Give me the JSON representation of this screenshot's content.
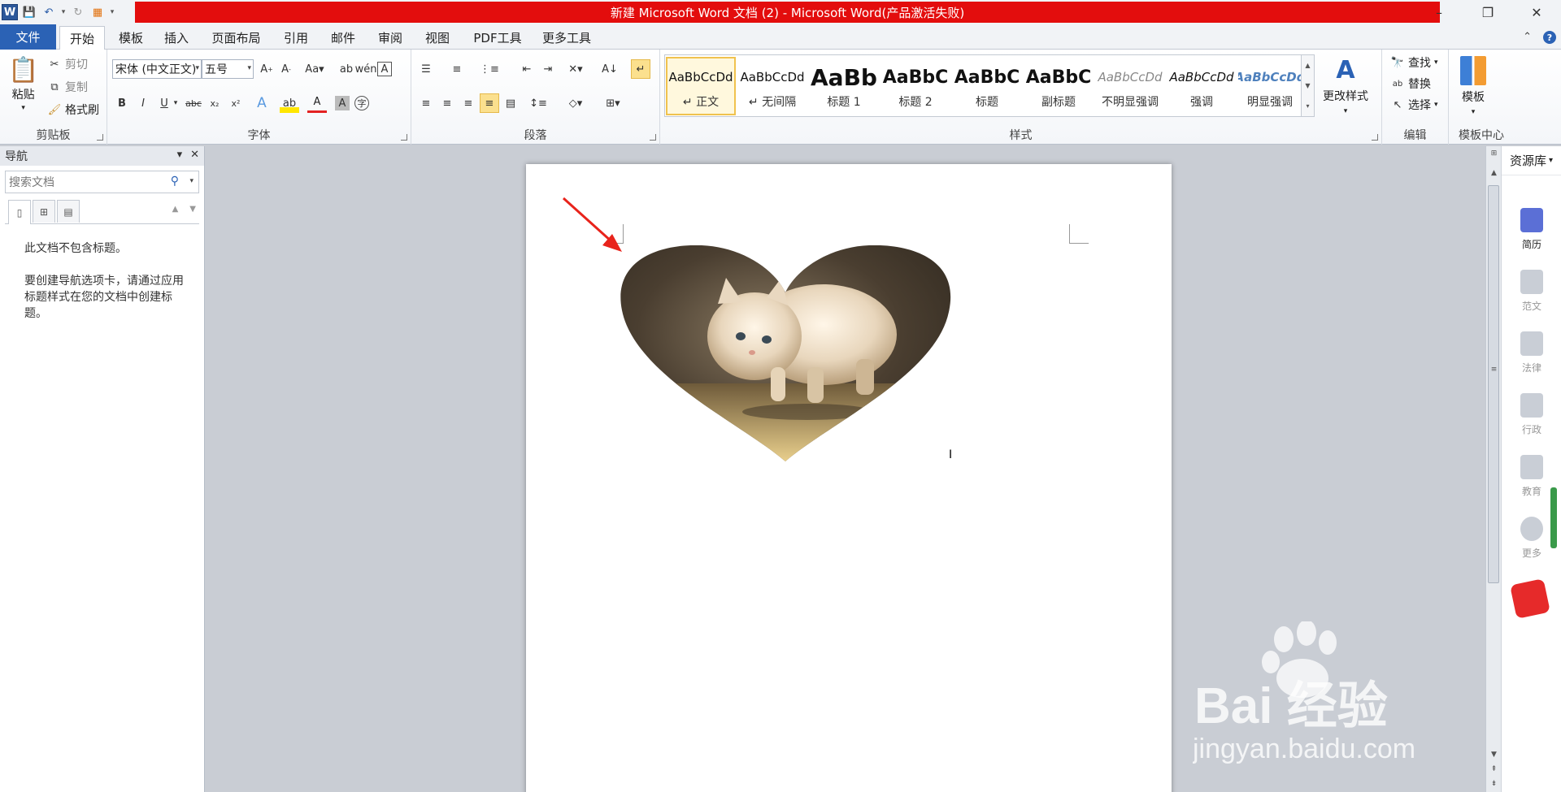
{
  "window": {
    "title": "新建 Microsoft Word 文档 (2) - Microsoft Word(产品激活失败)",
    "app_icon": "W",
    "controls": [
      "–",
      "❐",
      "✕"
    ]
  },
  "tabs": {
    "file": "文件",
    "items": [
      "开始",
      "模板",
      "插入",
      "页面布局",
      "引用",
      "邮件",
      "审阅",
      "视图",
      "PDF工具",
      "更多工具"
    ],
    "active_index": 0
  },
  "ribbon": {
    "clipboard": {
      "label": "剪贴板",
      "paste": "粘贴",
      "cut": "剪切",
      "copy": "复制",
      "format_painter": "格式刷"
    },
    "font": {
      "label": "字体",
      "family": "宋体 (中文正文)",
      "size": "五号"
    },
    "paragraph": {
      "label": "段落"
    },
    "styles": {
      "label": "样式",
      "items": [
        {
          "preview": "AaBbCcDd",
          "name": "↵ 正文"
        },
        {
          "preview": "AaBbCcDd",
          "name": "↵ 无间隔"
        },
        {
          "preview": "AaBb",
          "name": "标题 1"
        },
        {
          "preview": "AaBbC",
          "name": "标题 2"
        },
        {
          "preview": "AaBbC",
          "name": "标题"
        },
        {
          "preview": "AaBbC",
          "name": "副标题"
        },
        {
          "preview": "AaBbCcDd",
          "name": "不明显强调"
        },
        {
          "preview": "AaBbCcDd",
          "name": "强调"
        },
        {
          "preview": "AaBbCcDd",
          "name": "明显强调"
        }
      ],
      "change_styles": "更改样式"
    },
    "editing": {
      "label": "编辑",
      "find": "查找",
      "replace": "替换",
      "select": "选择"
    },
    "template_center": {
      "label": "模板中心",
      "button": "模板"
    }
  },
  "nav": {
    "title": "导航",
    "search_placeholder": "搜索文档",
    "message_1": "此文档不包含标题。",
    "message_2": "要创建导航选项卡，请通过应用标题样式在您的文档中创建标题。"
  },
  "resources": {
    "title": "资源库",
    "items": [
      "简历",
      "范文",
      "法律",
      "行政",
      "教育",
      "更多"
    ]
  },
  "watermark": {
    "brand": "Bai 经验",
    "url": "jingyan.baidu.com"
  },
  "colors": {
    "title_red": "#e30d0d",
    "file_tab": "#2b62b5",
    "arrow": "#e8231b"
  }
}
